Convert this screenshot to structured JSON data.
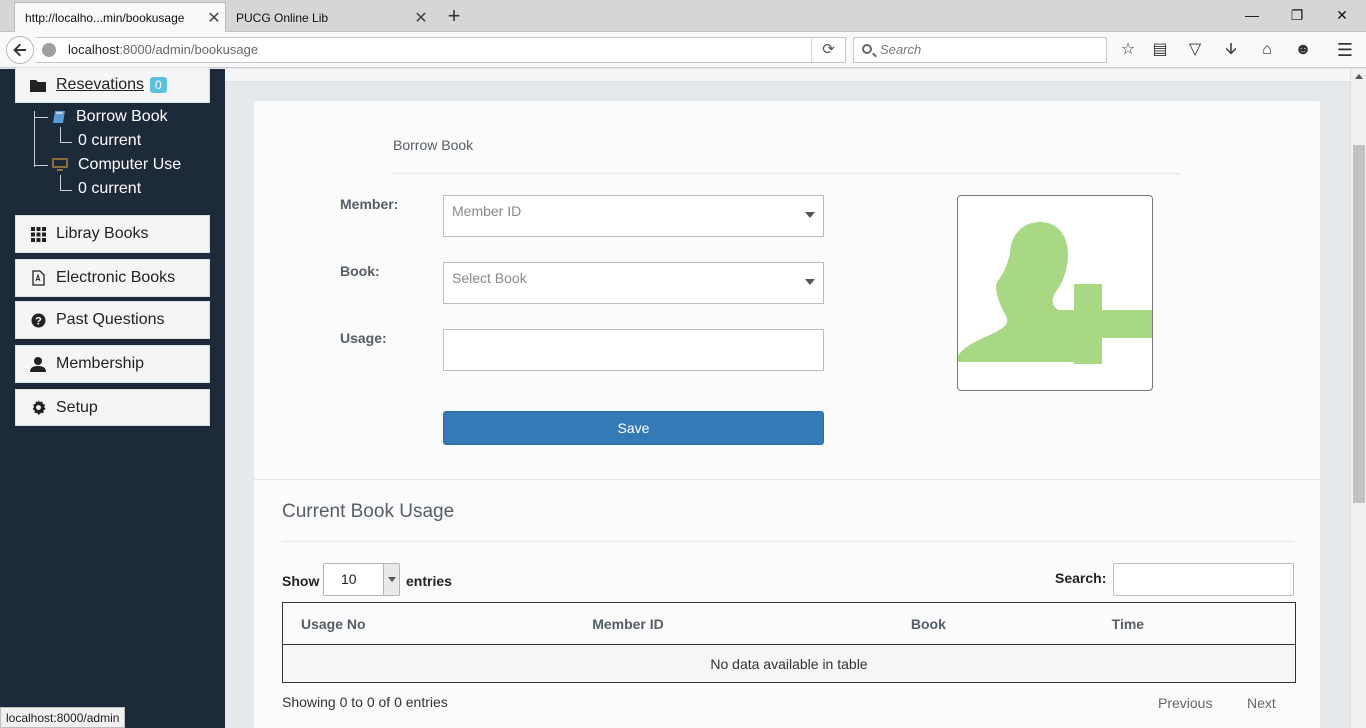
{
  "browser": {
    "tabs": [
      {
        "title": "http://localho...min/bookusage"
      },
      {
        "title": "PUCG Online Lib"
      }
    ],
    "new_tab": "+",
    "url_host": "localhost",
    "url_rest": ":8000/admin/bookusage",
    "search_placeholder": "Search",
    "status_tip": "localhost:8000/admin"
  },
  "sidebar": {
    "reservations": {
      "label": "Resevations",
      "badge": "0"
    },
    "tree": [
      {
        "label": "Borrow Book",
        "sub": "0 current"
      },
      {
        "label": "Computer Use",
        "sub": "0 current"
      }
    ],
    "items": [
      {
        "label": "Libray Books"
      },
      {
        "label": "Electronic Books"
      },
      {
        "label": "Past Questions"
      },
      {
        "label": "Membership"
      },
      {
        "label": "Setup"
      }
    ]
  },
  "form": {
    "heading": "Borrow Book",
    "member_label": "Member:",
    "member_placeholder": "Member ID",
    "book_label": "Book:",
    "book_placeholder": "Select Book",
    "usage_label": "Usage:",
    "usage_value": "",
    "save_label": "Save"
  },
  "usage": {
    "title": "Current Book Usage",
    "show_label": "Show",
    "page_size": "10",
    "entries_label": "entries",
    "search_label": "Search:",
    "columns": [
      "Usage No",
      "Member ID",
      "Book",
      "Time"
    ],
    "empty_text": "No data available in table",
    "info": "Showing 0 to 0 of 0 entries",
    "prev_label": "Previous",
    "next_label": "Next"
  },
  "colors": {
    "sidebar_bg": "#1d2a3a",
    "primary_button": "#337ab7",
    "avatar_green": "#a8d883",
    "badge": "#5bc0de"
  }
}
